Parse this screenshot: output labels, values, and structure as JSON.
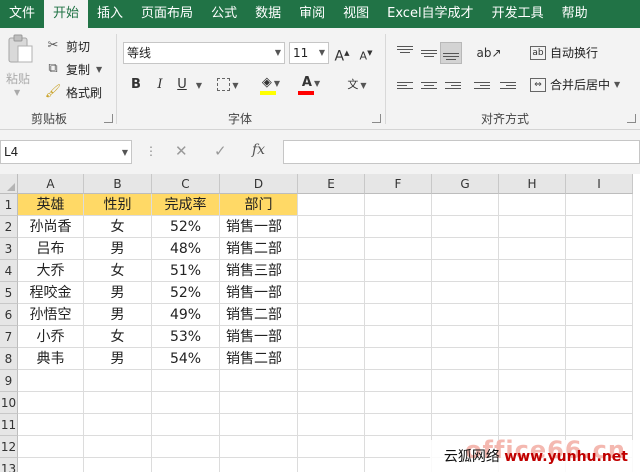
{
  "menu": {
    "tabs": [
      "文件",
      "开始",
      "插入",
      "页面布局",
      "公式",
      "数据",
      "审阅",
      "视图",
      "Excel自学成才",
      "开发工具",
      "帮助"
    ],
    "active_index": 1
  },
  "ribbon": {
    "clipboard": {
      "paste": "粘贴",
      "cut": "剪切",
      "copy": "复制",
      "format_painter": "格式刷",
      "group_label": "剪贴板"
    },
    "font": {
      "font_name": "等线",
      "font_size": "11",
      "bold": "B",
      "italic": "I",
      "underline": "U",
      "font_color": "A",
      "phonetic": "文",
      "grow": "A",
      "shrink": "A",
      "group_label": "字体"
    },
    "alignment": {
      "wrap_text": "自动换行",
      "merge_center": "合并后居中",
      "group_label": "对齐方式"
    },
    "accent_colors": {
      "font_color_bar": "#ff0000",
      "fill_color_bar": "#ffff00"
    }
  },
  "formula_bar": {
    "name_box": "L4",
    "fx": "fx",
    "value": ""
  },
  "grid": {
    "columns": [
      "A",
      "B",
      "C",
      "D",
      "E",
      "F",
      "G",
      "H",
      "I"
    ],
    "rows": [
      "1",
      "2",
      "3",
      "4",
      "5",
      "6",
      "7",
      "8",
      "9",
      "10",
      "11",
      "12",
      "13"
    ],
    "header_row": [
      "英雄",
      "性别",
      "完成率",
      "部门"
    ],
    "data": [
      [
        "孙尚香",
        "女",
        "52%",
        "销售一部"
      ],
      [
        "吕布",
        "男",
        "48%",
        "销售二部"
      ],
      [
        "大乔",
        "女",
        "51%",
        "销售三部"
      ],
      [
        "程咬金",
        "男",
        "52%",
        "销售一部"
      ],
      [
        "孙悟空",
        "男",
        "49%",
        "销售二部"
      ],
      [
        "小乔",
        "女",
        "53%",
        "销售一部"
      ],
      [
        "典韦",
        "男",
        "54%",
        "销售二部"
      ]
    ],
    "header_fill": "#ffd966"
  },
  "watermark": {
    "ghost": "office66.cn",
    "site_name": "云狐网络",
    "url": "www.yunhu.net"
  },
  "theme": {
    "excel_green": "#217346"
  }
}
